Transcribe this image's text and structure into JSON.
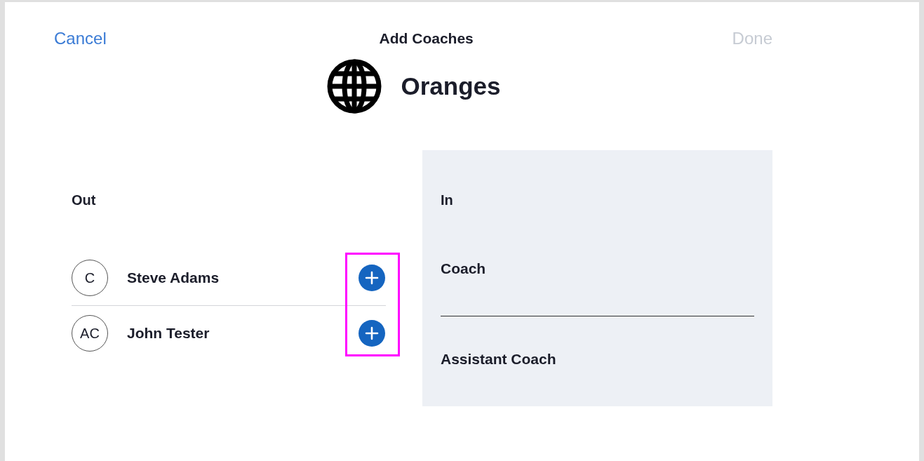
{
  "header": {
    "cancel": "Cancel",
    "title": "Add Coaches",
    "done": {
      "label": "Done",
      "disabled": true
    }
  },
  "team": {
    "name": "Oranges"
  },
  "out": {
    "heading": "Out",
    "people": [
      {
        "initials": "C",
        "name": "Steve Adams"
      },
      {
        "initials": "AC",
        "name": "John Tester"
      }
    ]
  },
  "in": {
    "heading": "In",
    "roles": [
      "Coach",
      "Assistant Coach"
    ]
  }
}
